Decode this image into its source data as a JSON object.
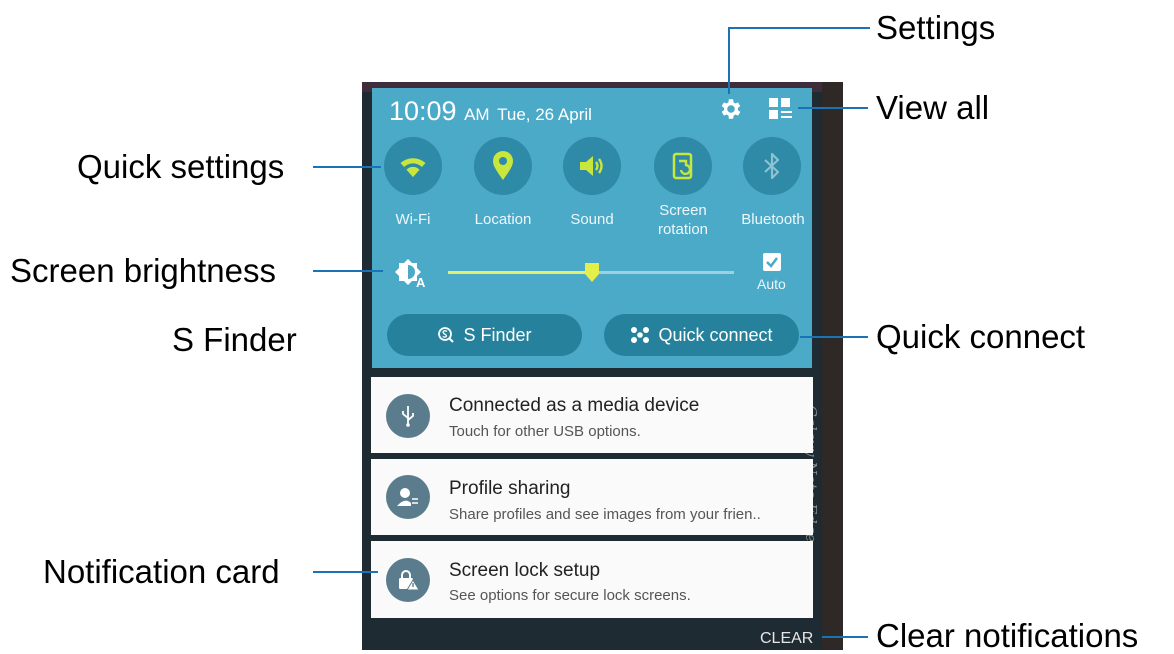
{
  "callouts": {
    "settings": "Settings",
    "view_all": "View all",
    "quick_settings": "Quick settings",
    "screen_brightness": "Screen brightness",
    "s_finder": "S Finder",
    "quick_connect": "Quick connect",
    "notification_card": "Notification card",
    "clear_notifications": "Clear notifications"
  },
  "status": {
    "time": "10:09",
    "ampm": "AM",
    "date": "Tue, 26 April"
  },
  "quick_settings": [
    {
      "label": "Wi-Fi",
      "icon": "wifi-icon",
      "active": true
    },
    {
      "label": "Location",
      "icon": "location-icon",
      "active": true
    },
    {
      "label": "Sound",
      "icon": "sound-icon",
      "active": true
    },
    {
      "label": "Screen\nrotation",
      "icon": "screen-rotation-icon",
      "active": true
    },
    {
      "label": "Bluetooth",
      "icon": "bluetooth-icon",
      "active": false
    }
  ],
  "brightness": {
    "level": 0.5,
    "auto_label": "Auto",
    "auto_checked": true
  },
  "buttons": {
    "s_finder": "S Finder",
    "quick_connect": "Quick connect"
  },
  "notifications": [
    {
      "title": "Connected as a media device",
      "subtitle": "Touch for other USB options.",
      "icon": "usb-icon"
    },
    {
      "title": "Profile sharing",
      "subtitle": "Share profiles and see images from your frien..",
      "icon": "profile-sharing-icon"
    },
    {
      "title": "Screen lock setup",
      "subtitle": "See options for secure lock screens.",
      "icon": "screen-lock-icon"
    }
  ],
  "clear_label": "CLEAR",
  "edge_text": "Galaxy Note Edge",
  "colors": {
    "panel": "#4aaac8",
    "toggle_bg": "#2e8aa6",
    "accent": "#c8e63c",
    "callout_line": "#1a73b5"
  }
}
